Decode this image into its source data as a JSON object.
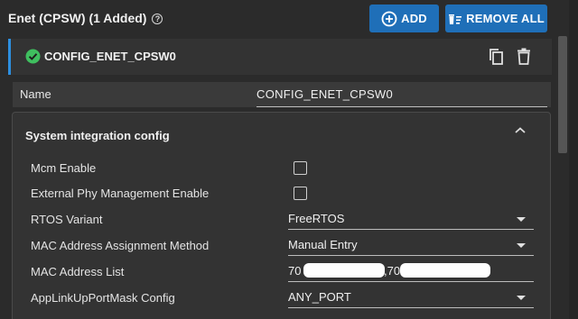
{
  "header": {
    "title": "Enet (CPSW) (1 Added)",
    "add_label": "ADD",
    "remove_all_label": "REMOVE ALL"
  },
  "config": {
    "name": "CONFIG_ENET_CPSW0",
    "status": "valid"
  },
  "name_field": {
    "label": "Name",
    "value": "CONFIG_ENET_CPSW0"
  },
  "section": {
    "title": "System integration config",
    "fields": [
      {
        "label": "Mcm Enable",
        "type": "checkbox",
        "checked": false
      },
      {
        "label": "External Phy Management Enable",
        "type": "checkbox",
        "checked": false
      },
      {
        "label": "RTOS Variant",
        "type": "select",
        "value": "FreeRTOS"
      },
      {
        "label": "MAC Address Assignment Method",
        "type": "select",
        "value": "Manual Entry"
      },
      {
        "label": "MAC Address List",
        "type": "text",
        "value_parts": [
          "70",
          ",70"
        ]
      },
      {
        "label": "AppLinkUpPortMask Config",
        "type": "select",
        "value": "ANY_PORT"
      }
    ]
  },
  "colors": {
    "accent": "#1f6fb8",
    "status_ok": "#3fbf5f",
    "background": "#2b2b2b",
    "panel": "#333333"
  },
  "icons": [
    "help-icon",
    "add-circle-icon",
    "remove-all-icon",
    "check-circle-icon",
    "copy-icon",
    "trash-icon",
    "chevron-up-icon",
    "chevron-down-icon"
  ]
}
